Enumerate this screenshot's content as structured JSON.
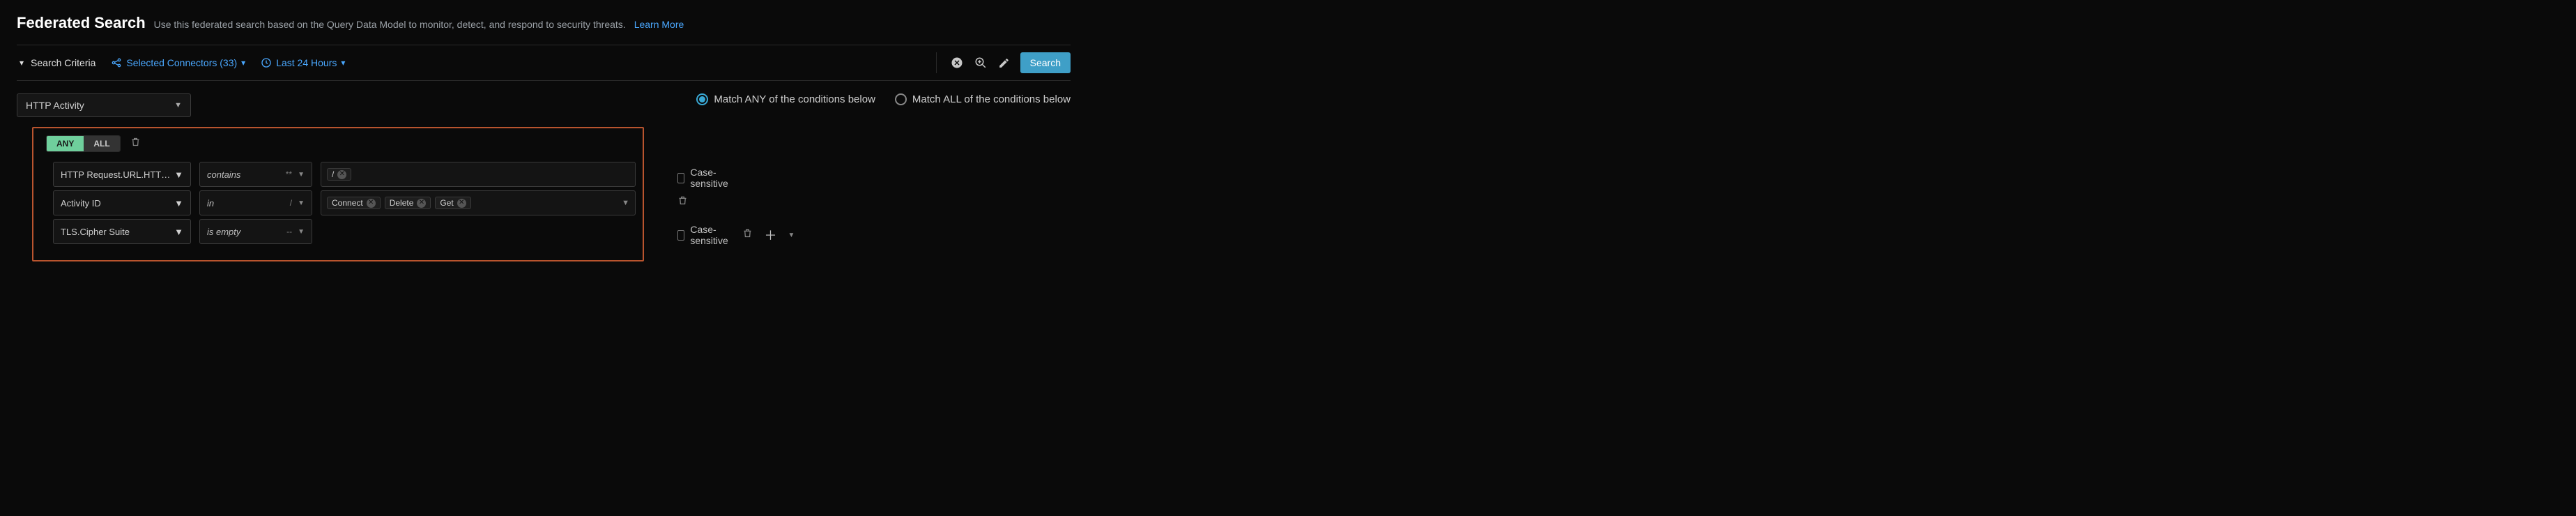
{
  "header": {
    "title": "Federated Search",
    "subtitle": "Use this federated search based on the Query Data Model to monitor, detect, and respond to security threats.",
    "learn_more": "Learn More"
  },
  "criteria": {
    "label": "Search Criteria",
    "connectors": "Selected Connectors (33)",
    "time_range": "Last 24 Hours",
    "search_button": "Search"
  },
  "type_select": {
    "value": "HTTP Activity"
  },
  "match": {
    "any_label": "Match ANY of the conditions below",
    "all_label": "Match ALL of the conditions below",
    "selected": "any"
  },
  "segmented": {
    "any": "ANY",
    "all": "ALL"
  },
  "rows": [
    {
      "field": "HTTP Request.URL.HTTP Qu…",
      "op": "contains",
      "op_hint": "**",
      "chips": [
        "/"
      ],
      "has_case_sensitive": true,
      "has_dropdown_caret": false
    },
    {
      "field": "Activity ID",
      "op": "in",
      "op_hint": "/",
      "chips": [
        "Connect",
        "Delete",
        "Get"
      ],
      "has_case_sensitive": false,
      "has_dropdown_caret": true,
      "has_trash": true
    },
    {
      "field": "TLS.Cipher Suite",
      "op": "is empty",
      "op_hint": "--",
      "chips": [],
      "no_value_box": true,
      "has_case_sensitive": true,
      "has_trash": true,
      "has_add": true
    }
  ],
  "labels": {
    "case_sensitive": "Case-sensitive"
  }
}
